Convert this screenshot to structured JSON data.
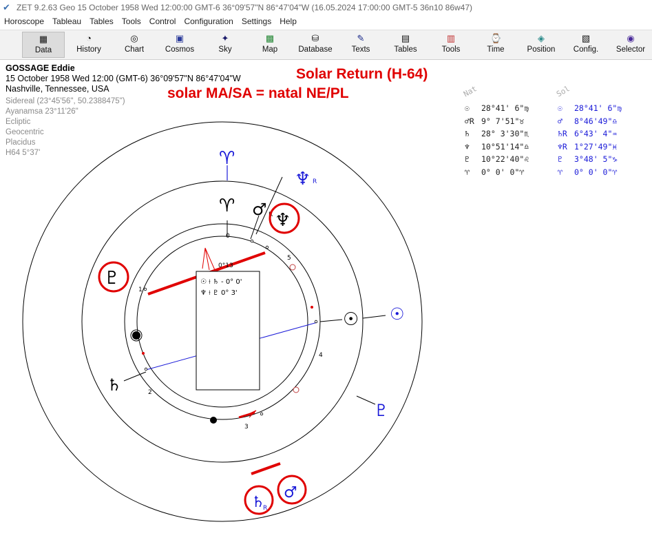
{
  "window": {
    "title": "ZET 9.2.63 Geo   15 October 1958  Wed  12:00:00 GMT-6 36°09'57\"N  86°47'04\"W  (16.05.2024  17:00:00 GMT-5 36n10 86w47)"
  },
  "menu": [
    "Horoscope",
    "Tableau",
    "Tables",
    "Tools",
    "Control",
    "Configuration",
    "Settings",
    "Help"
  ],
  "toolbar": [
    {
      "label": "Data",
      "icon": "data-icon"
    },
    {
      "label": "History",
      "icon": "history-icon"
    },
    {
      "label": "Chart",
      "icon": "chart-icon"
    },
    {
      "label": "Cosmos",
      "icon": "cosmos-icon"
    },
    {
      "label": "Sky",
      "icon": "sky-icon"
    },
    {
      "label": "Map",
      "icon": "map-icon"
    },
    {
      "label": "Database",
      "icon": "database-icon"
    },
    {
      "label": "Texts",
      "icon": "texts-icon"
    },
    {
      "label": "Tables",
      "icon": "tables-icon"
    },
    {
      "label": "Tools",
      "icon": "tools-icon"
    },
    {
      "label": "Time",
      "icon": "time-icon"
    },
    {
      "label": "Position",
      "icon": "position-icon"
    },
    {
      "label": "Config.",
      "icon": "config-icon"
    },
    {
      "label": "Selector",
      "icon": "selector-icon"
    }
  ],
  "person": {
    "name": "GOSSAGE Eddie",
    "datetime": "15 October 1958  Wed  12:00 (GMT-6) 36°09'57\"N  86°47'04\"W",
    "place": "Nashville, Tennessee, USA"
  },
  "settings": [
    "Sidereal (23°45'56\", 50.2388475\")",
    "Ayanamsa 23°11'26\"",
    "Ecliptic",
    "Geocentric",
    "Placidus",
    "H64   5°37'"
  ],
  "annotation": {
    "line1": "Solar Return (H-64)",
    "line2": "solar MA/SA = natal NE/PL"
  },
  "natal_table": {
    "header": "Nat",
    "rows": [
      {
        "glyph": "☉",
        "pos": "28°41' 6\"♍"
      },
      {
        "glyph": "♂R",
        "pos": "9° 7'51\"♉"
      },
      {
        "glyph": "♄",
        "pos": "28° 3'30\"♏"
      },
      {
        "glyph": "♆",
        "pos": "10°51'14\"♎"
      },
      {
        "glyph": "♇",
        "pos": "10°22'40\"♌"
      },
      {
        "glyph": "♈",
        "pos": "0° 0' 0\"♈"
      }
    ]
  },
  "solar_table": {
    "header": "Sol",
    "rows": [
      {
        "glyph": "☉",
        "pos": "28°41' 6\"♍"
      },
      {
        "glyph": "♂",
        "pos": "8°46'49\"♎"
      },
      {
        "glyph": "♄R",
        "pos": "6°43' 4\"♒"
      },
      {
        "glyph": "♆R",
        "pos": "1°27'49\"♓"
      },
      {
        "glyph": "♇",
        "pos": "3°48' 5\"♑"
      },
      {
        "glyph": "♈",
        "pos": "0° 0' 0\"♈"
      }
    ]
  },
  "midpoint_box": {
    "row1": "☉ ⟊ ♄ - 0° 0'",
    "row2": "♆ ⟊ ♇   0° 3'",
    "angle_label": "0°13"
  },
  "house_numbers": [
    "0",
    "5",
    "1",
    "4",
    "2",
    "3"
  ],
  "glyphs": {
    "aries_outer": "♈",
    "aries_inner": "♈",
    "neptune_solar": "♆",
    "neptune_solar_flag": "R",
    "mars_natal": "♂",
    "mars_natal_flag": "R",
    "neptune_natal": "♆",
    "pluto_natal": "♇",
    "sun_natal": "☉",
    "sun_solar": "☉",
    "saturn_natal": "♄",
    "pluto_solar": "♇",
    "saturn_solar": "♄",
    "saturn_solar_flag": "R",
    "mars_solar": "♂"
  },
  "colors": {
    "solar_blue": "#1a1ad8",
    "highlight_red": "#e00000",
    "natal_black": "#000000"
  }
}
